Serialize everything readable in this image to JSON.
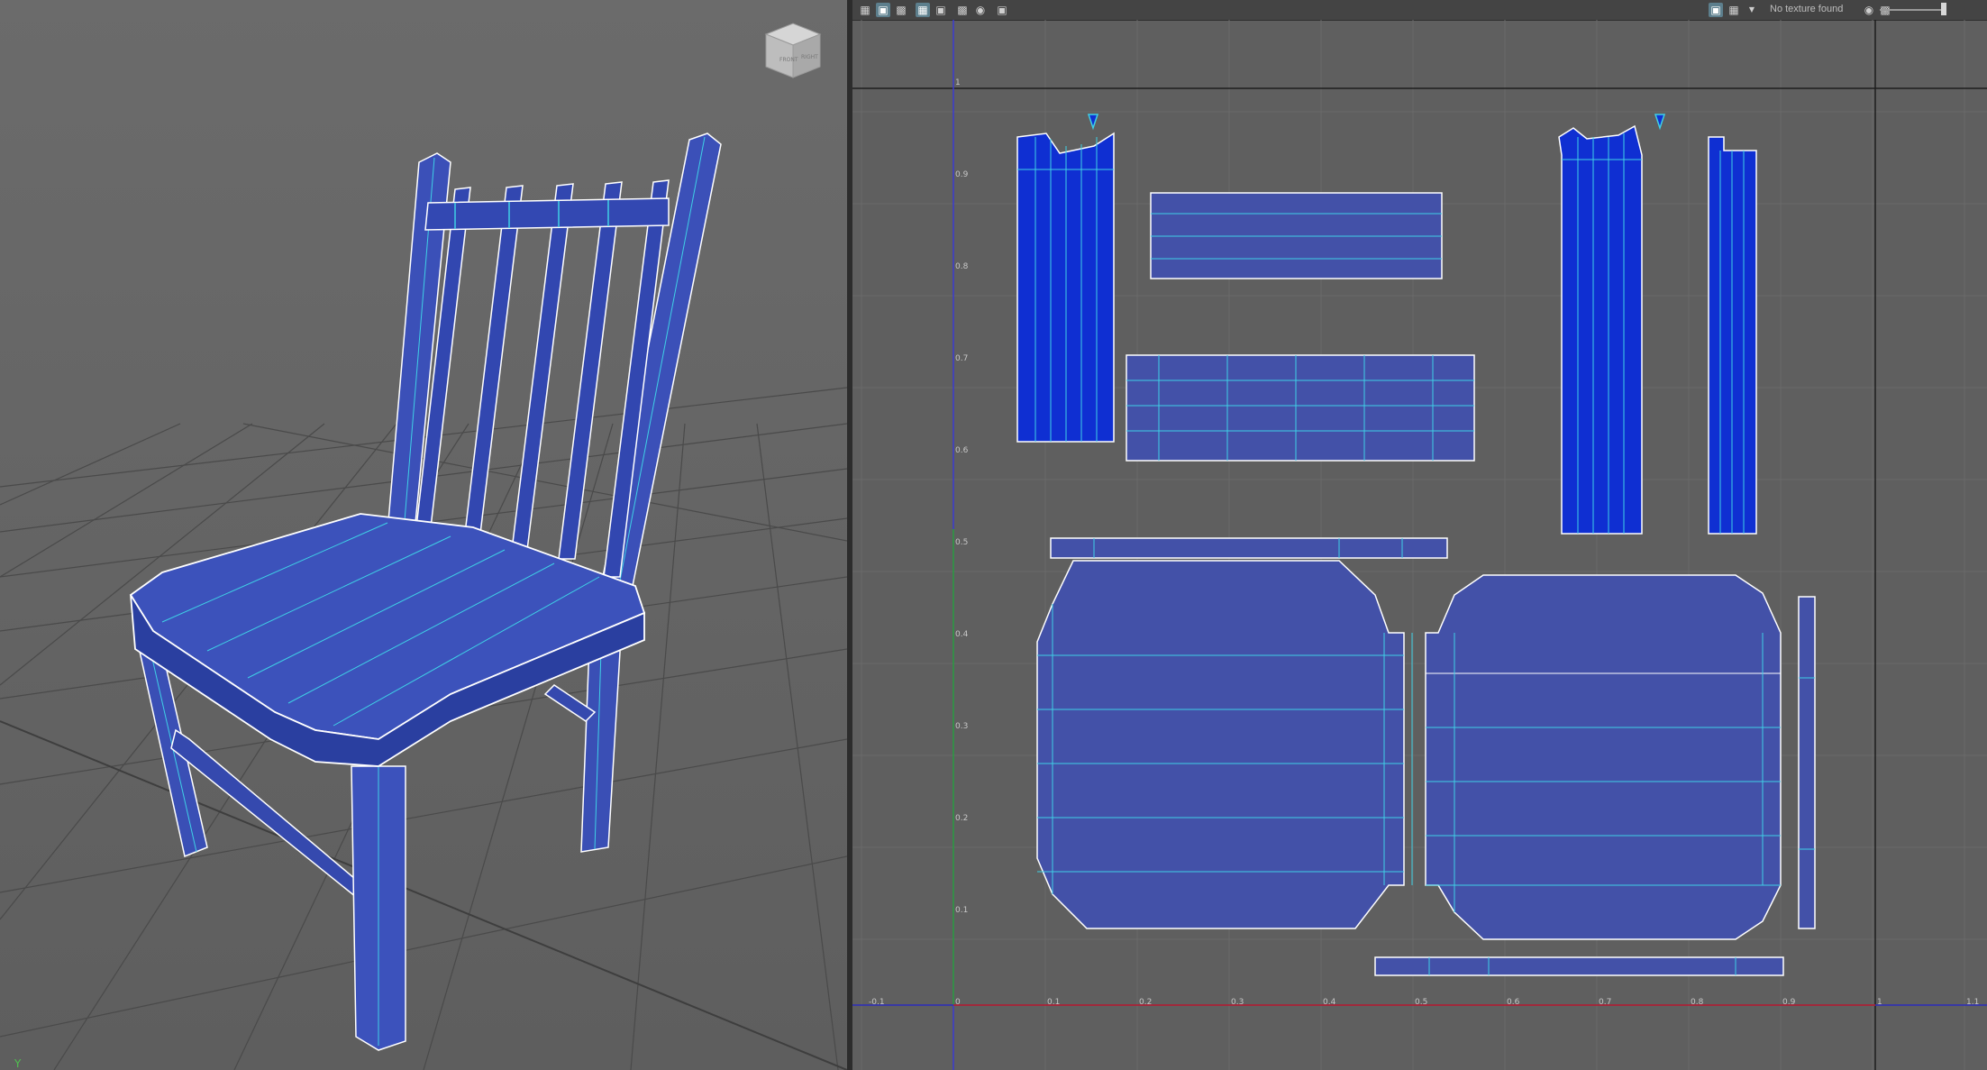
{
  "viewport": {
    "view_cube": {
      "front": "FRONT",
      "right": "RIGHT"
    },
    "axis_indicator": "Y"
  },
  "uv_editor": {
    "toolbar": {
      "icons": [
        "uv-layout-icon",
        "uv-select-icon",
        "texture-icon",
        "grid-icon",
        "uv-shell-icon",
        "checker-icon",
        "shading-icon",
        "snapshot-icon"
      ],
      "right_icons": [
        "image-display-icon",
        "checker-display-icon",
        "dropdown-arrow-icon"
      ],
      "texture_status": "No texture found",
      "far_right_icons": [
        "exposure-icon",
        "image-icon"
      ]
    },
    "u_ticks": [
      "-0.1",
      "0",
      "0.1",
      "0.2",
      "0.3",
      "0.4",
      "0.5",
      "0.6",
      "0.7",
      "0.8",
      "0.9",
      "1",
      "1.1"
    ],
    "v_ticks": [
      "0.1",
      "0.2",
      "0.3",
      "0.4",
      "0.5",
      "0.6",
      "0.7",
      "0.8",
      "0.9",
      "1"
    ],
    "colors": {
      "uv_face": "#4351a8",
      "uv_face_selected": "#0f2fd2",
      "edge": "#3fd0e6",
      "border": "#ffffff",
      "u_axis": "#c02020",
      "v_axis": "#2fa12f"
    }
  }
}
